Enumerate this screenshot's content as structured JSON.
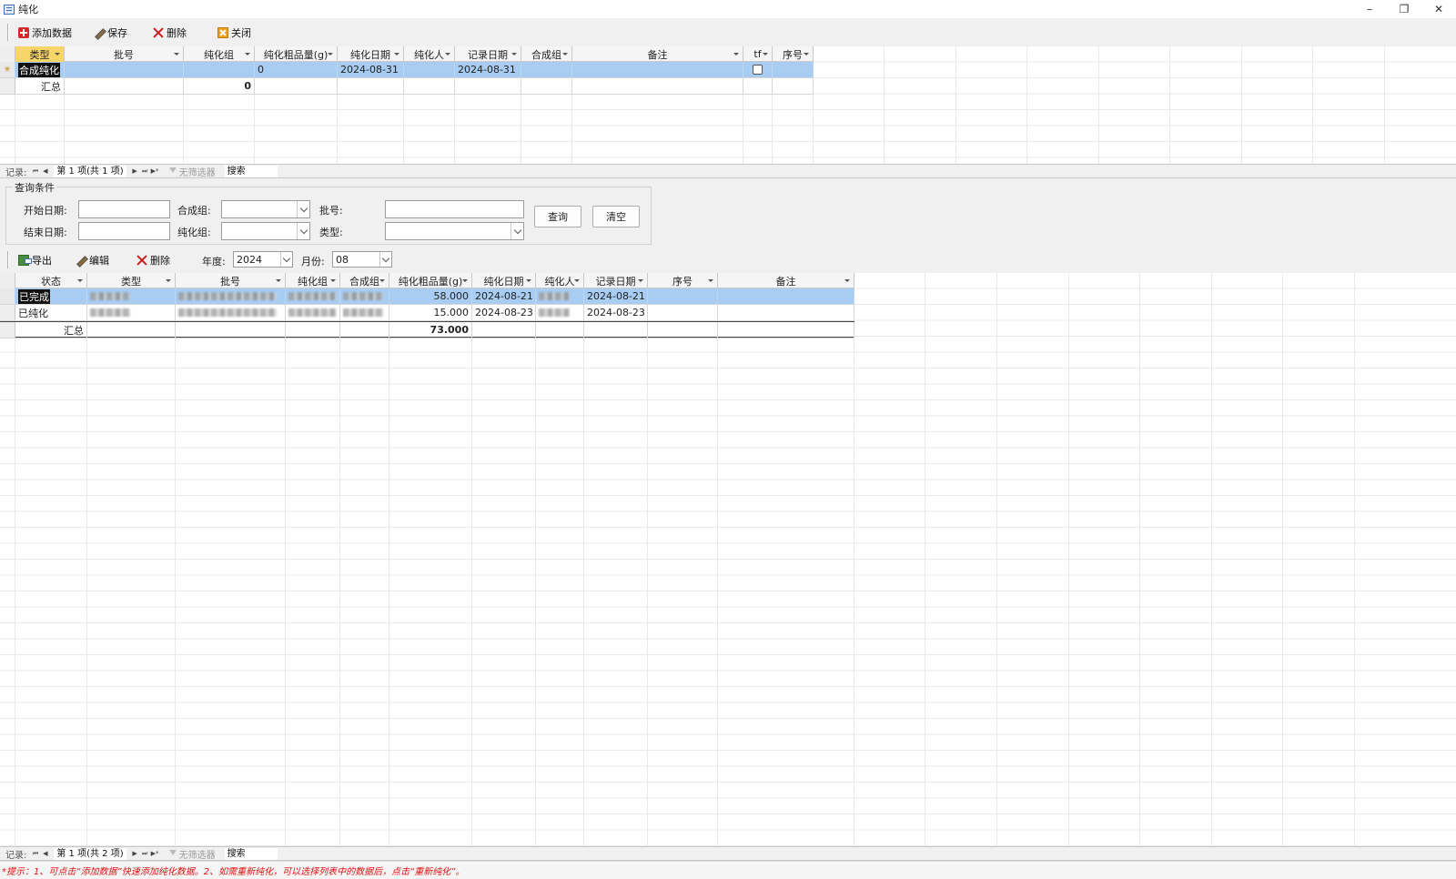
{
  "window": {
    "title": "纯化",
    "minimize": "–",
    "restore": "❐",
    "close": "✕"
  },
  "toolbar": {
    "add_label": "添加数据",
    "save_label": "保存",
    "delete_label": "删除",
    "close_label": "关闭"
  },
  "top_grid": {
    "columns": [
      "类型",
      "批号",
      "纯化组",
      "纯化粗品量(g)",
      "纯化日期",
      "纯化人",
      "记录日期",
      "合成组",
      "备注",
      "tf",
      "序号"
    ],
    "new_row": {
      "marker": "✳",
      "type": "合成纯化",
      "crude_amount": "0",
      "purify_date": "2024-08-31",
      "record_date": "2024-08-31"
    },
    "total": {
      "label": "汇总",
      "value": "0"
    }
  },
  "top_nav": {
    "record_label": "记录:",
    "first": "⏮",
    "prev": "◀",
    "position": "第 1 项(共 1 项)",
    "next": "▶",
    "last": "⏭",
    "new": "▶*",
    "filter": "无筛选器",
    "search": "搜索"
  },
  "query": {
    "legend": "查询条件",
    "start_date_label": "开始日期:",
    "end_date_label": "结束日期:",
    "synth_group_label": "合成组:",
    "purify_group_label": "纯化组:",
    "batch_label": "批号:",
    "type_label": "类型:",
    "query_button": "查询",
    "clear_button": "清空"
  },
  "toolbar2": {
    "export_label": "导出",
    "edit_label": "编辑",
    "delete_label": "删除",
    "year_label": "年度:",
    "year_value": "2024",
    "month_label": "月份:",
    "month_value": "08"
  },
  "bottom_grid": {
    "columns": [
      "状态",
      "类型",
      "批号",
      "纯化组",
      "合成组",
      "纯化粗品量(g)",
      "纯化日期",
      "纯化人",
      "记录日期",
      "序号",
      "备注"
    ],
    "rows": [
      {
        "status": "已完成",
        "amount": "58.000",
        "purify_date": "2024-08-21",
        "record_date": "2024-08-21"
      },
      {
        "status": "已纯化",
        "amount": "15.000",
        "purify_date": "2024-08-23",
        "record_date": "2024-08-23"
      }
    ],
    "total": {
      "label": "汇总",
      "value": "73.000"
    }
  },
  "bottom_nav": {
    "record_label": "记录:",
    "first": "⏮",
    "prev": "◀",
    "position": "第 1 项(共 2 项)",
    "next": "▶",
    "last": "⏭",
    "new": "▶*",
    "filter": "无筛选器",
    "search": "搜索"
  },
  "hint": "*提示：1、可点击“添加数据”快速添加纯化数据。2、如需重新纯化，可以选择列表中的数据后，点击“重新纯化”。"
}
